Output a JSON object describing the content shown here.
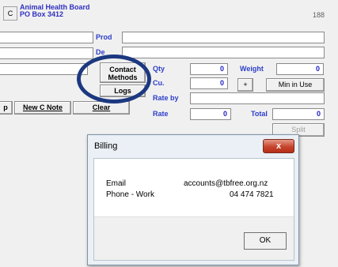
{
  "header": {
    "c_button": "C",
    "company_name": "Animal Health Board",
    "company_address": "PO Box 3412",
    "record_number": "188"
  },
  "form": {
    "prod_label": "Prod",
    "des_label": "De",
    "contact_methods_label": "Contact Methods",
    "logs_label": "Logs",
    "qty_label": "Qty",
    "qty_value": "0",
    "weight_label": "Weight",
    "weight_value": "0",
    "cu_label": "Cu.",
    "cu_value": "0",
    "plus_label": "+",
    "min_in_use_label": "Min in Use",
    "rate_by_label": "Rate by",
    "rate_label": "Rate",
    "rate_value": "0",
    "total_label": "Total",
    "total_value": "0",
    "split_label": "Split",
    "new_c_note_label": "New C Note",
    "clear_label": "Clear",
    "partial_left_button": "p"
  },
  "dialog": {
    "title": "Billing",
    "close_glyph": "x",
    "rows": [
      {
        "label": "Email",
        "value": "accounts@tbfree.org.nz"
      },
      {
        "label": "Phone - Work",
        "value": "04 474 7821"
      }
    ],
    "ok_label": "OK"
  },
  "colors": {
    "label_blue": "#2c3ec8",
    "highlight_ring": "#1c3880",
    "close_red": "#c7442c"
  }
}
